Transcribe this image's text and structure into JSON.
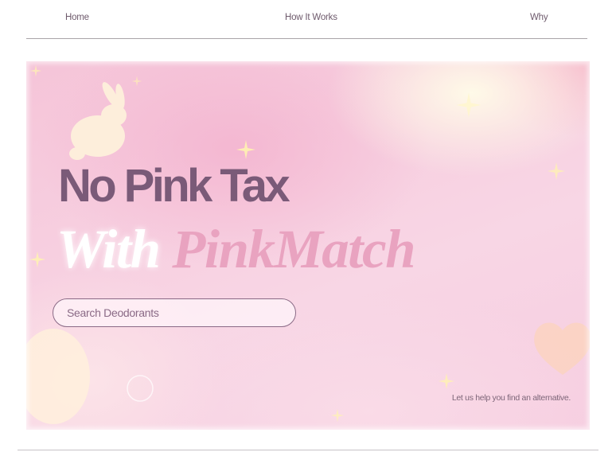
{
  "nav": {
    "items": [
      {
        "label": "Home"
      },
      {
        "label": "How It Works"
      },
      {
        "label": "Why"
      }
    ]
  },
  "hero": {
    "headline_line1": "No Pink Tax",
    "headline_word_with": "With",
    "headline_brand": "PinkMatch",
    "search": {
      "placeholder": "Search Deodorants",
      "value": ""
    },
    "tagline": "Let us  help you find an alternative."
  },
  "colors": {
    "headline": "#7a5a78",
    "brand": "#e9a3c0",
    "nav_text": "#6e5a6c",
    "background_pink": "#f7cfe0"
  },
  "icons": [
    "bunny-icon",
    "sparkle-icon",
    "heart-icon",
    "bubble-icon"
  ]
}
